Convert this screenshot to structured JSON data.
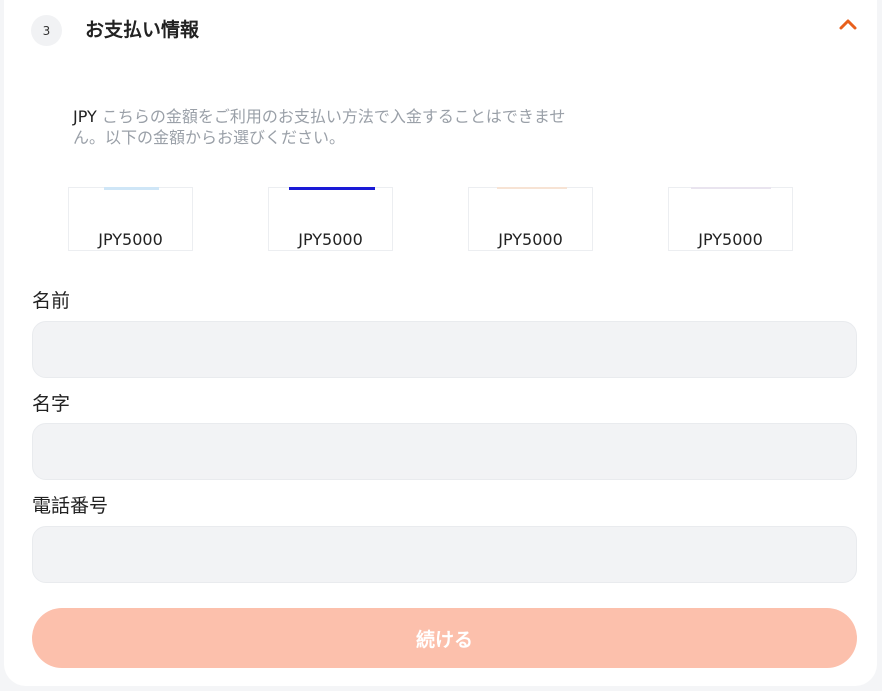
{
  "section": {
    "step_number": "3",
    "title": "お支払い情報",
    "chevron_icon": "chevron-up-icon",
    "accent_color": "#e8601c"
  },
  "notice": {
    "currency": "JPY",
    "text": "こちらの金額をご利用のお支払い方法で入金することはできません。以下の金額からお選びください。"
  },
  "amounts": [
    {
      "label": "JPY5000",
      "strip_color": "#cfe6f7"
    },
    {
      "label": "JPY5000",
      "strip_color": "#1a1ad6"
    },
    {
      "label": "JPY5000",
      "strip_color": "#f7e3d4"
    },
    {
      "label": "JPY5000",
      "strip_color": "#e9e4ef"
    }
  ],
  "form": {
    "first_name_label": "名前",
    "last_name_label": "名字",
    "phone_label": "電話番号"
  },
  "submit_label": "続ける",
  "submit_color": "#fcc0ac"
}
